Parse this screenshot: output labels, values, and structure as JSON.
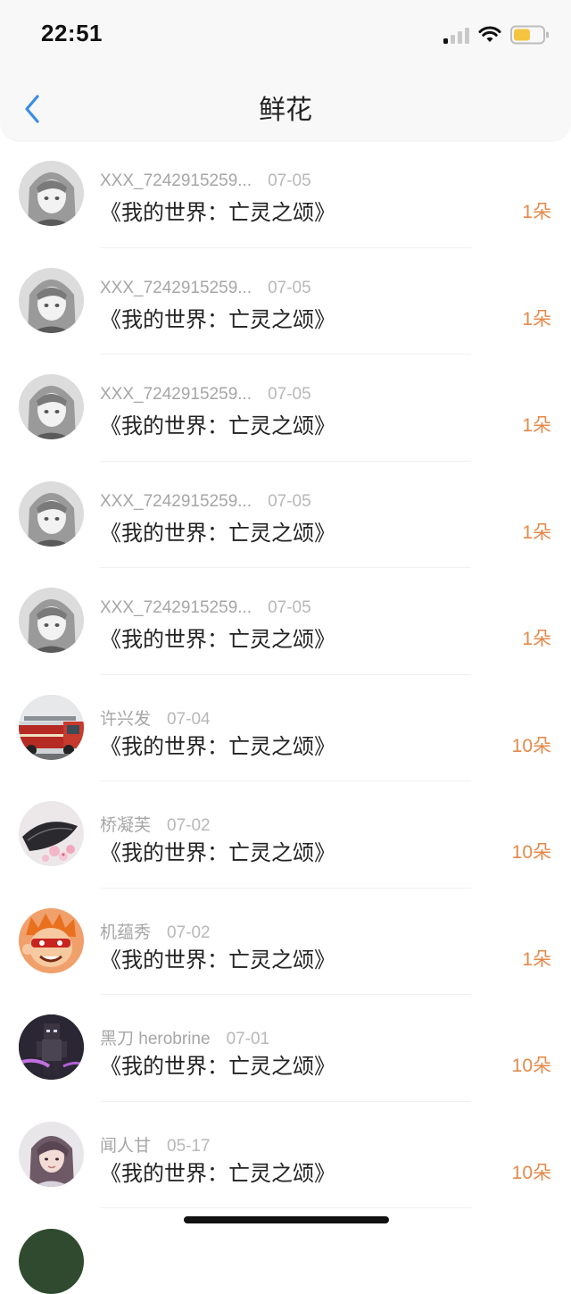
{
  "status_bar": {
    "time": "22:51",
    "icons": [
      "signal-icon",
      "wifi-icon",
      "battery-icon"
    ]
  },
  "nav": {
    "back_icon": "chevron-left-icon",
    "title": "鲜花"
  },
  "colors": {
    "accent_back": "#3a8ee6",
    "count_orange": "#e5894a",
    "meta_gray": "#a6a6a6",
    "battery_yellow": "#f5c542"
  },
  "flowers": [
    {
      "user": "XXX_7242915259...",
      "date": "07-05",
      "book": "《我的世界：亡灵之颂》",
      "count": "1朵",
      "avatar": "anime-girl-avatar"
    },
    {
      "user": "XXX_7242915259...",
      "date": "07-05",
      "book": "《我的世界：亡灵之颂》",
      "count": "1朵",
      "avatar": "anime-girl-avatar"
    },
    {
      "user": "XXX_7242915259...",
      "date": "07-05",
      "book": "《我的世界：亡灵之颂》",
      "count": "1朵",
      "avatar": "anime-girl-avatar"
    },
    {
      "user": "XXX_7242915259...",
      "date": "07-05",
      "book": "《我的世界：亡灵之颂》",
      "count": "1朵",
      "avatar": "anime-girl-avatar"
    },
    {
      "user": "XXX_7242915259...",
      "date": "07-05",
      "book": "《我的世界：亡灵之颂》",
      "count": "1朵",
      "avatar": "anime-girl-avatar"
    },
    {
      "user": "许兴发",
      "date": "07-04",
      "book": "《我的世界：亡灵之颂》",
      "count": "10朵",
      "avatar": "fire-truck-avatar"
    },
    {
      "user": "桥凝芙",
      "date": "07-02",
      "book": "《我的世界：亡灵之颂》",
      "count": "10朵",
      "avatar": "flowers-fan-avatar"
    },
    {
      "user": "机蕴秀",
      "date": "07-02",
      "book": "《我的世界：亡灵之颂》",
      "count": "1朵",
      "avatar": "cartoon-face-avatar"
    },
    {
      "user": "黑刀 herobrine",
      "date": "07-01",
      "book": "《我的世界：亡灵之颂》",
      "count": "10朵",
      "avatar": "minecraft-herobrine-avatar"
    },
    {
      "user": "闻人甘",
      "date": "05-17",
      "book": "《我的世界：亡灵之颂》",
      "count": "10朵",
      "avatar": "portrait-avatar"
    }
  ]
}
